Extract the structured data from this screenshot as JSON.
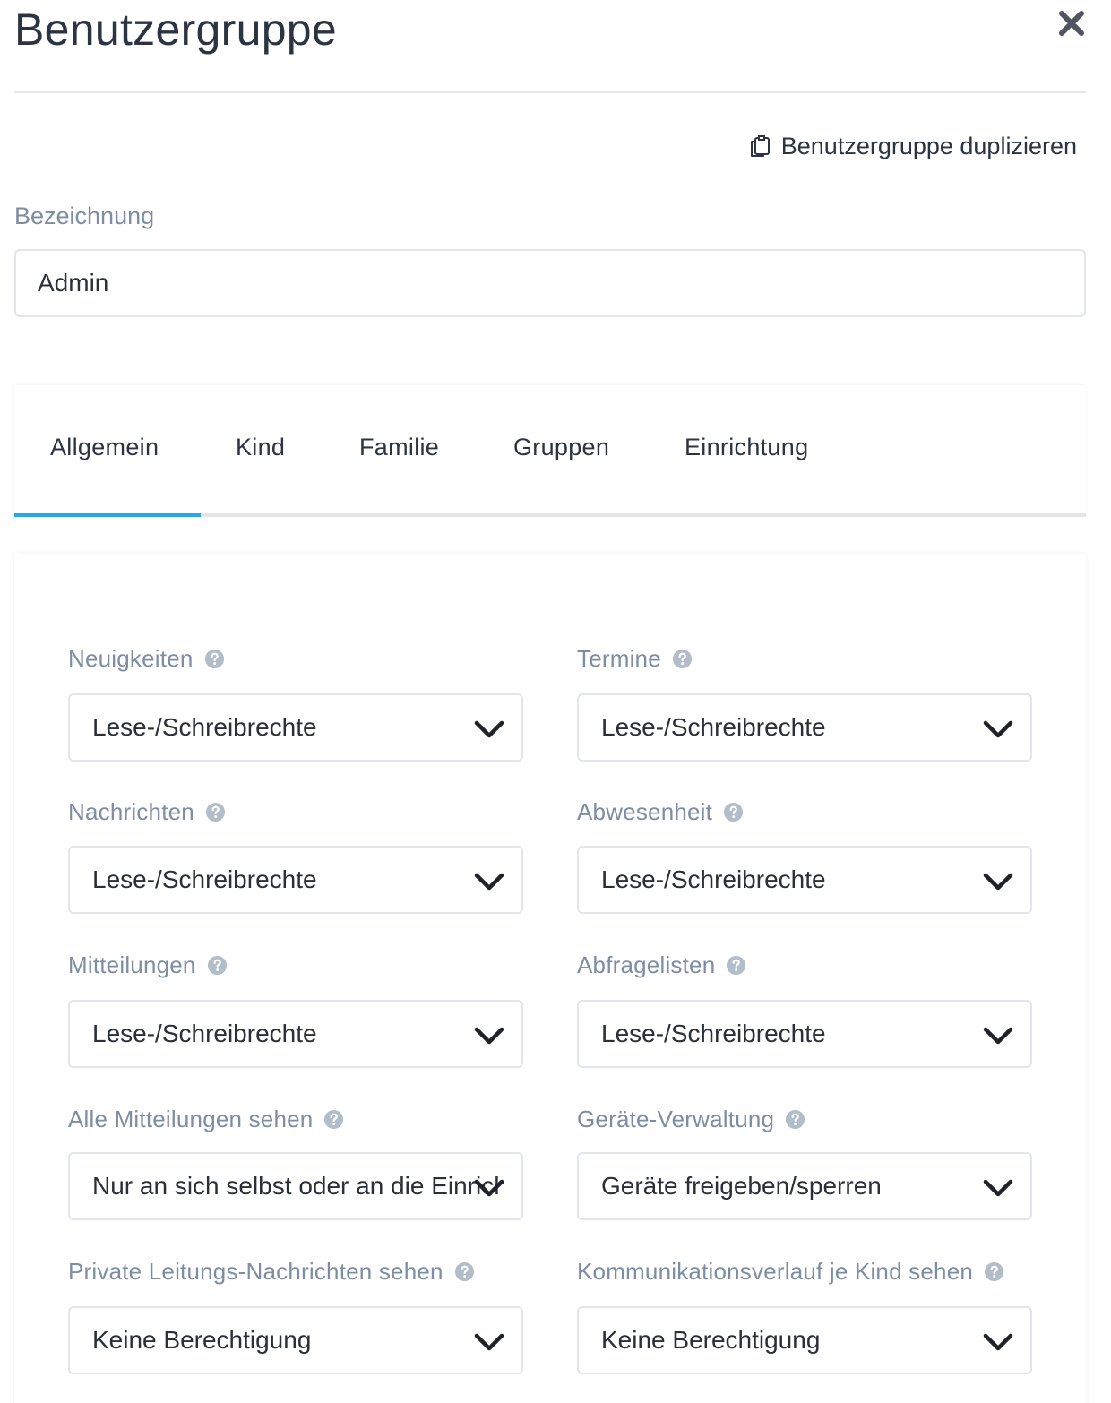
{
  "modal": {
    "title": "Benutzergruppe",
    "duplicate_label": "Benutzergruppe duplizieren"
  },
  "name_field": {
    "label": "Bezeichnung",
    "value": "Admin"
  },
  "tabs": [
    {
      "label": "Allgemein",
      "active": true
    },
    {
      "label": "Kind",
      "active": false
    },
    {
      "label": "Familie",
      "active": false
    },
    {
      "label": "Gruppen",
      "active": false
    },
    {
      "label": "Einrichtung",
      "active": false
    }
  ],
  "colors": {
    "accent": "#29a8e8",
    "label": "#7e8da3",
    "text": "#2c3442"
  },
  "permissions": [
    {
      "label": "Neuigkeiten",
      "value": "Lese-/Schreibrechte"
    },
    {
      "label": "Termine",
      "value": "Lese-/Schreibrechte"
    },
    {
      "label": "Nachrichten",
      "value": "Lese-/Schreibrechte"
    },
    {
      "label": "Abwesenheit",
      "value": "Lese-/Schreibrechte"
    },
    {
      "label": "Mitteilungen",
      "value": "Lese-/Schreibrechte"
    },
    {
      "label": "Abfragelisten",
      "value": "Lese-/Schreibrechte"
    },
    {
      "label": "Alle Mitteilungen sehen",
      "value": "Nur an sich selbst oder an die Einrichtung"
    },
    {
      "label": "Geräte-Verwaltung",
      "value": "Geräte freigeben/sperren"
    },
    {
      "label": "Private Leitungs-Nachrichten sehen",
      "value": "Keine Berechtigung"
    },
    {
      "label": "Kommunikationsverlauf je Kind sehen",
      "value": "Keine Berechtigung"
    }
  ]
}
